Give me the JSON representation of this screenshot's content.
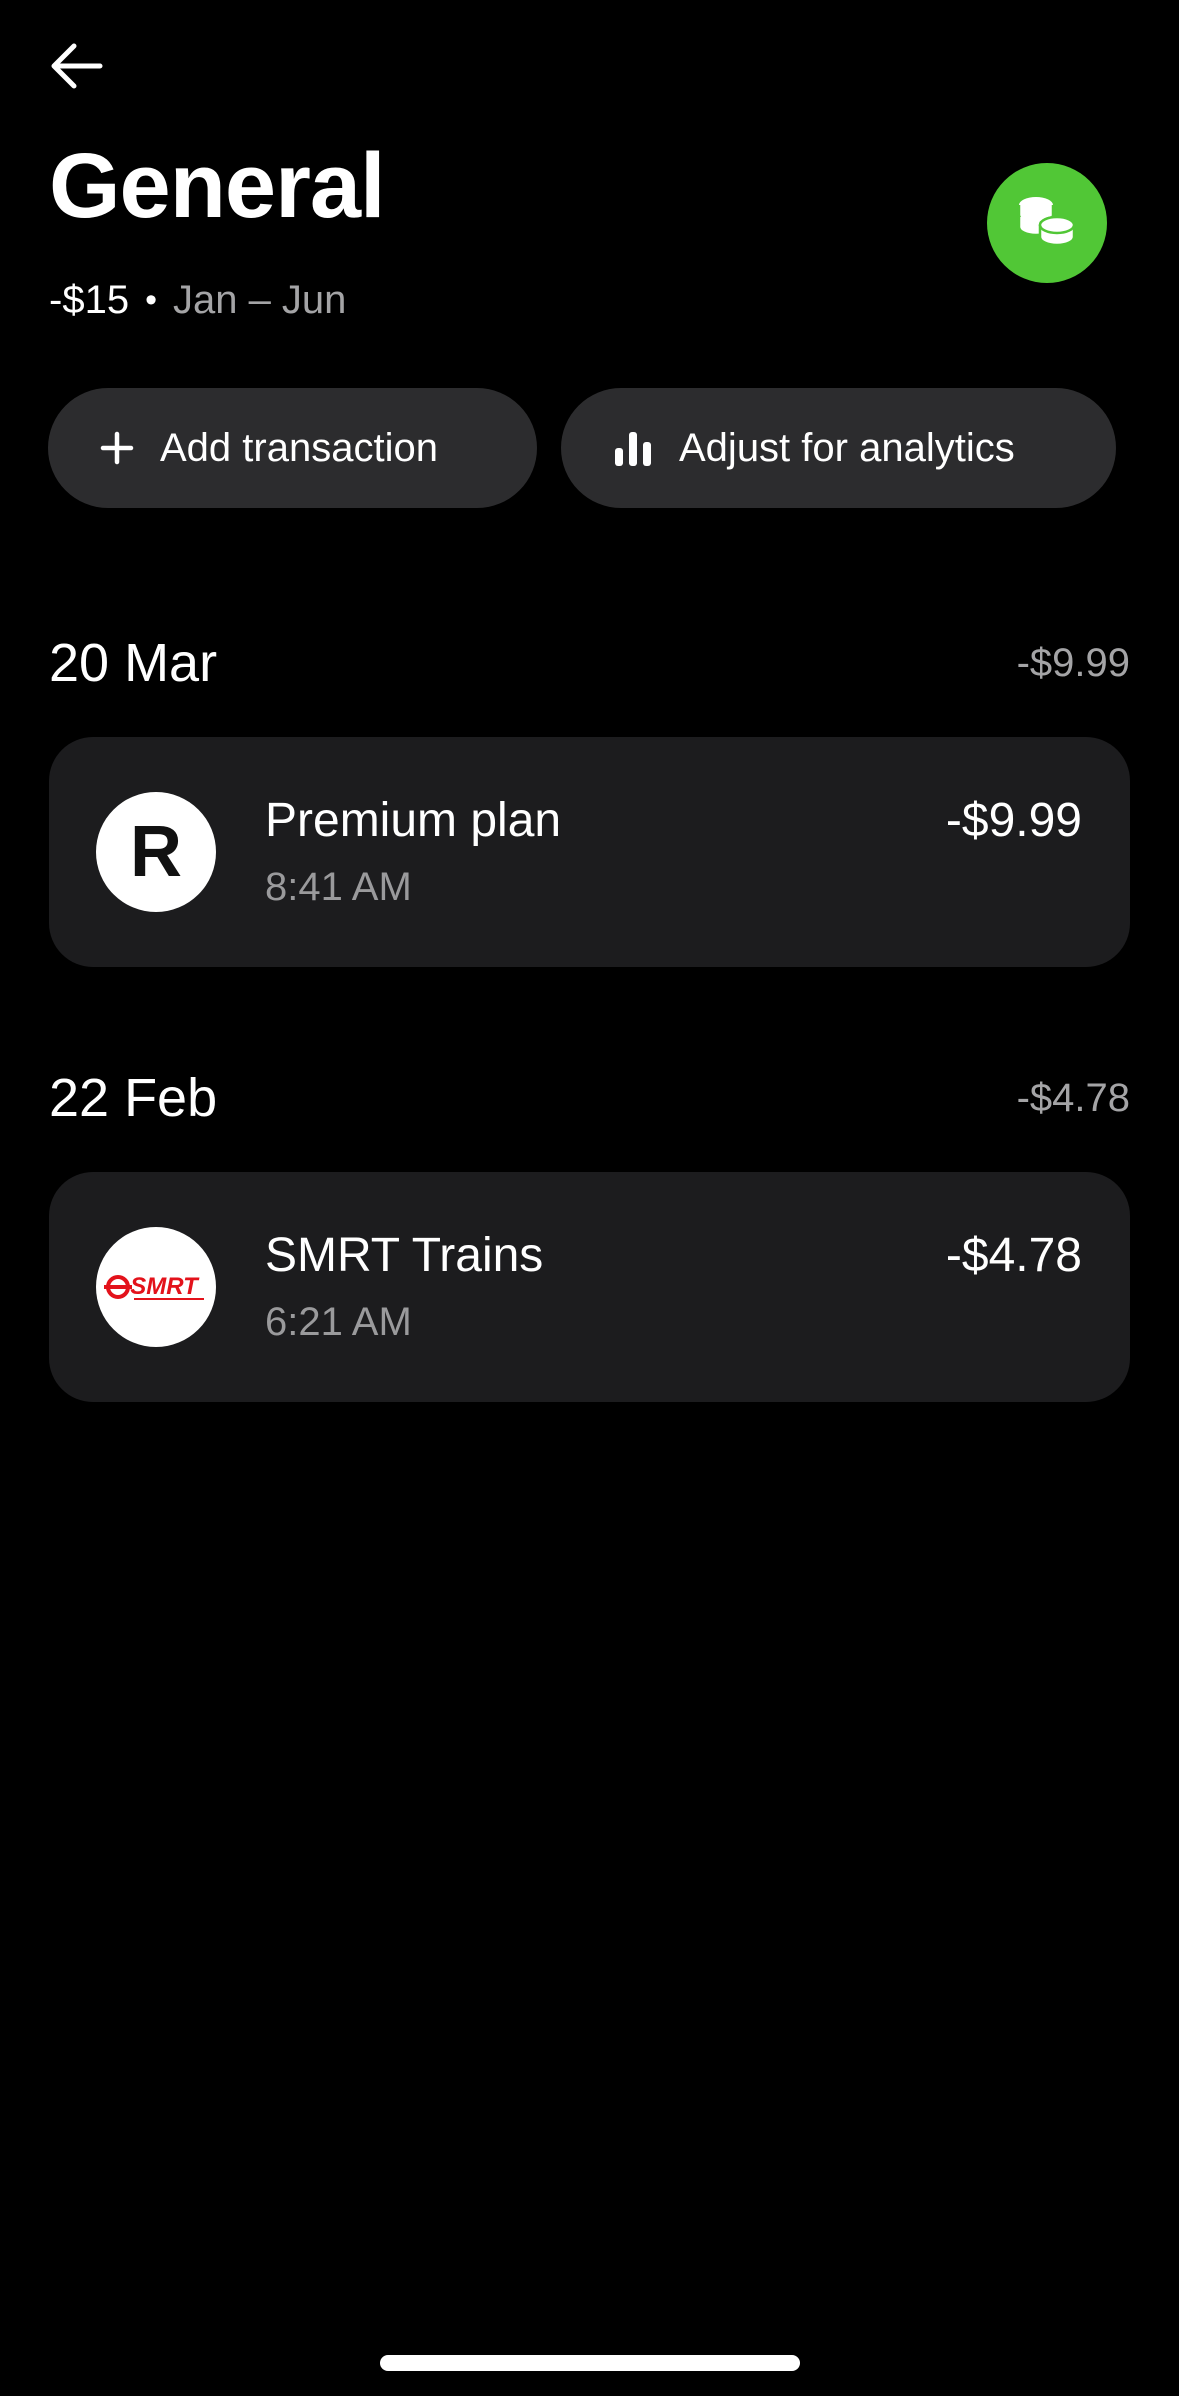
{
  "header": {
    "title": "General",
    "subtitle_amount": "-$15",
    "subtitle_separator": "•",
    "subtitle_range": "Jan – Jun",
    "back_icon": "arrow-left-icon",
    "category_icon": "coins-icon",
    "category_color": "#51c736"
  },
  "actions": {
    "add_label": "Add transaction",
    "add_icon": "plus-icon",
    "adjust_label": "Adjust for analytics",
    "adjust_icon": "bar-chart-icon"
  },
  "groups": [
    {
      "date": "20 Mar",
      "total": "-$9.99",
      "transactions": [
        {
          "name": "Premium plan",
          "time": "8:41 AM",
          "amount": "-$9.99",
          "logo": "revolut-logo",
          "logo_text": "R"
        }
      ]
    },
    {
      "date": "22 Feb",
      "total": "-$4.78",
      "transactions": [
        {
          "name": "SMRT Trains",
          "time": "6:21 AM",
          "amount": "-$4.78",
          "logo": "smrt-logo",
          "logo_text": "SMRT"
        }
      ]
    }
  ],
  "colors": {
    "background": "#000000",
    "pill": "#2c2c2e",
    "card": "#1c1c1e",
    "muted_text": "#a4a4a6",
    "smrt_red": "#e3121b"
  }
}
